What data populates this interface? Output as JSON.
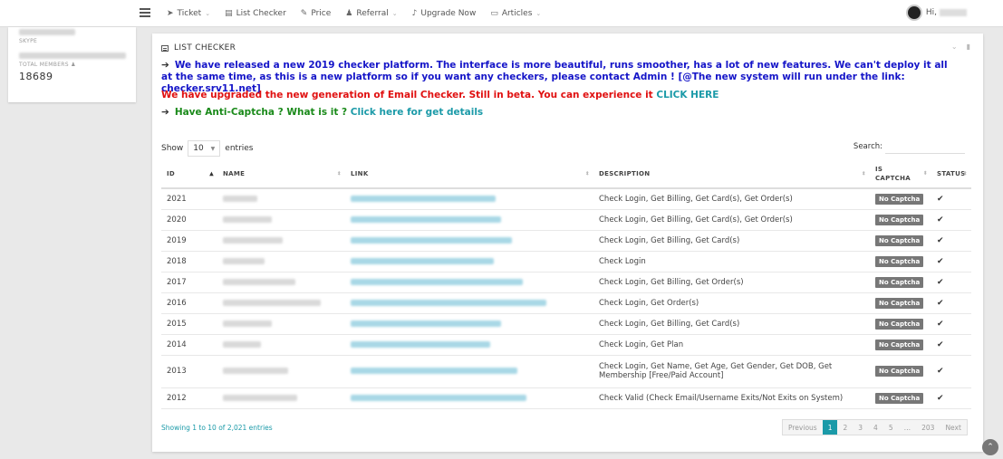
{
  "nav": {
    "items": [
      {
        "icon": "paper-plane-icon",
        "glyph": "➤",
        "label": "Ticket",
        "caret": true
      },
      {
        "icon": "book-icon",
        "glyph": "▤",
        "label": "List Checker",
        "caret": false
      },
      {
        "icon": "tags-icon",
        "glyph": "✎",
        "label": "Price",
        "caret": false
      },
      {
        "icon": "users-icon",
        "glyph": "♟",
        "label": "Referral",
        "caret": true
      },
      {
        "icon": "bell-icon",
        "glyph": "♪",
        "label": "Upgrade Now",
        "caret": false
      },
      {
        "icon": "newspaper-icon",
        "glyph": "▭",
        "label": "Articles",
        "caret": true
      }
    ],
    "greeting": "Hi,"
  },
  "left_card": {
    "skype_label": "SKYPE",
    "members_label": "TOTAL MEMBERS",
    "members_value": "18689"
  },
  "panel": {
    "title": "LIST CHECKER",
    "notice1": "We have released a new 2019 checker platform. The interface is more beautiful, runs smoother, has a lot of new features. We can't deploy it all at the same time, as this is a new platform so if you want any checkers, please contact Admin ! [@The new system will run under the link: checker.srv11.net]",
    "notice2_text": "We have upgraded the new generation of Email Checker. Still in beta. You can experience it ",
    "notice2_link": "CLICK HERE",
    "notice3_text": "Have Anti-Captcha ? What is it ? ",
    "notice3_link": "Click here for get details"
  },
  "table": {
    "show_label": "Show",
    "page_size": "10",
    "entries_label": "entries",
    "search_label": "Search:",
    "headers": {
      "id": "ID",
      "name": "NAME",
      "link": "LINK",
      "description": "DESCRIPTION",
      "captcha_1": "IS",
      "captcha_2": "CAPTCHA",
      "status": "STATUS"
    },
    "rows": [
      {
        "id": "2021",
        "description": "Check Login, Get Billing, Get Card(s), Get Order(s)",
        "captcha": "No Captcha",
        "name_w": 38,
        "link_w": 160
      },
      {
        "id": "2020",
        "description": "Check Login, Get Billing, Get Card(s), Get Order(s)",
        "captcha": "No Captcha",
        "name_w": 54,
        "link_w": 166
      },
      {
        "id": "2019",
        "description": "Check Login, Get Billing, Get Card(s)",
        "captcha": "No Captcha",
        "name_w": 66,
        "link_w": 178
      },
      {
        "id": "2018",
        "description": "Check Login",
        "captcha": "No Captcha",
        "name_w": 46,
        "link_w": 158
      },
      {
        "id": "2017",
        "description": "Check Login, Get Billing, Get Order(s)",
        "captcha": "No Captcha",
        "name_w": 80,
        "link_w": 190
      },
      {
        "id": "2016",
        "description": "Check Login, Get Order(s)",
        "captcha": "No Captcha",
        "name_w": 108,
        "link_w": 216
      },
      {
        "id": "2015",
        "description": "Check Login, Get Billing, Get Card(s)",
        "captcha": "No Captcha",
        "name_w": 54,
        "link_w": 166
      },
      {
        "id": "2014",
        "description": "Check Login, Get Plan",
        "captcha": "No Captcha",
        "name_w": 42,
        "link_w": 154
      },
      {
        "id": "2013",
        "description": "Check Login, Get Name, Get Age, Get Gender, Get DOB, Get Membership [Free/Paid Account]",
        "captcha": "No Captcha",
        "name_w": 72,
        "link_w": 184
      },
      {
        "id": "2012",
        "description": "Check Valid (Check Email/Username Exits/Not Exits on System)",
        "captcha": "No Captcha",
        "name_w": 82,
        "link_w": 194
      }
    ],
    "info": "Showing 1 to 10 of 2,021 entries",
    "pagination": {
      "previous": "Previous",
      "pages": [
        "1",
        "2",
        "3",
        "4",
        "5",
        "…",
        "203"
      ],
      "next": "Next",
      "active": "1"
    }
  }
}
